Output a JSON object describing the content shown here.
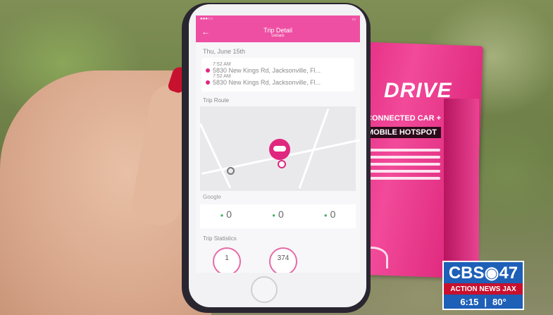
{
  "app": {
    "title": "Trip Detail",
    "subtitle": "Details",
    "date": "Thu, June 15th",
    "trip": {
      "start_time": "7:52 AM",
      "start_address": "5830 New Kings Rd, Jacksonville, Fl...",
      "end_time": "7:52 AM",
      "end_address": "5830 New Kings Rd, Jacksonville, Fl..."
    },
    "trip_route_label": "Trip Route",
    "google_label": "Google",
    "stats": [
      {
        "value": "0"
      },
      {
        "value": "0"
      },
      {
        "value": "0"
      }
    ],
    "trip_statistics_label": "Trip Statistics",
    "circles": [
      "1",
      "374"
    ]
  },
  "box": {
    "title": "DRIVE",
    "line1": "CONNECTED CAR +",
    "line2": "MOBILE HOTSPOT"
  },
  "logo": {
    "top": "CBS◉47",
    "mid": "ACTION NEWS JAX",
    "time": "6:15",
    "sep": "|",
    "temp": "80°"
  },
  "colors": {
    "accent": "#ee4fa3",
    "logo_blue": "#1e5fb8",
    "logo_red": "#c8102e"
  }
}
